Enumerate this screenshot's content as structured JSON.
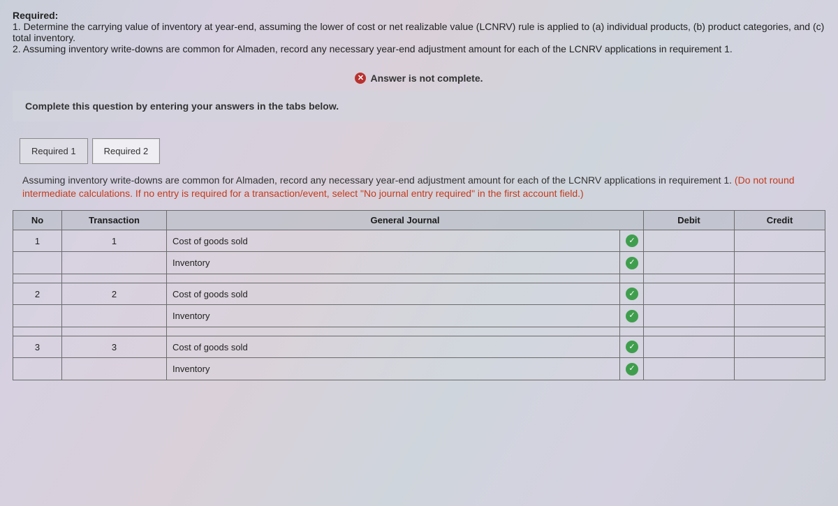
{
  "required": {
    "heading": "Required:",
    "line1": "1. Determine the carrying value of inventory at year-end, assuming the lower of cost or net realizable value (LCNRV) rule is applied to (a) individual products, (b) product categories, and (c) total inventory.",
    "line2": "2. Assuming inventory write-downs are common for Almaden, record any necessary year-end adjustment amount for each of the LCNRV applications in requirement 1."
  },
  "status": {
    "text": "Answer is not complete."
  },
  "prompt": "Complete this question by entering your answers in the tabs below.",
  "tabs": [
    {
      "label": "Required 1",
      "active": false
    },
    {
      "label": "Required 2",
      "active": true
    }
  ],
  "instructions": {
    "main": "Assuming inventory write-downs are common for Almaden, record any necessary year-end adjustment amount for each of the LCNRV applications in requirement 1. ",
    "red": "(Do not round intermediate calculations. If no entry is required for a transaction/event, select \"No journal entry required\" in the first account field.)"
  },
  "table": {
    "headers": {
      "no": "No",
      "tx": "Transaction",
      "gj": "General Journal",
      "debit": "Debit",
      "credit": "Credit"
    },
    "rows": [
      {
        "no": "1",
        "tx": "1",
        "gj": "Cost of goods sold",
        "check": true,
        "debit": "",
        "credit": ""
      },
      {
        "no": "",
        "tx": "",
        "gj": "Inventory",
        "check": true,
        "debit": "",
        "credit": ""
      },
      {
        "no": "",
        "tx": "",
        "gj": "",
        "check": false,
        "debit": "",
        "credit": ""
      },
      {
        "no": "2",
        "tx": "2",
        "gj": "Cost of goods sold",
        "check": true,
        "debit": "",
        "credit": ""
      },
      {
        "no": "",
        "tx": "",
        "gj": "Inventory",
        "check": true,
        "debit": "",
        "credit": ""
      },
      {
        "no": "",
        "tx": "",
        "gj": "",
        "check": false,
        "debit": "",
        "credit": ""
      },
      {
        "no": "3",
        "tx": "3",
        "gj": "Cost of goods sold",
        "check": true,
        "debit": "",
        "credit": ""
      },
      {
        "no": "",
        "tx": "",
        "gj": "Inventory",
        "check": true,
        "debit": "",
        "credit": ""
      }
    ]
  }
}
